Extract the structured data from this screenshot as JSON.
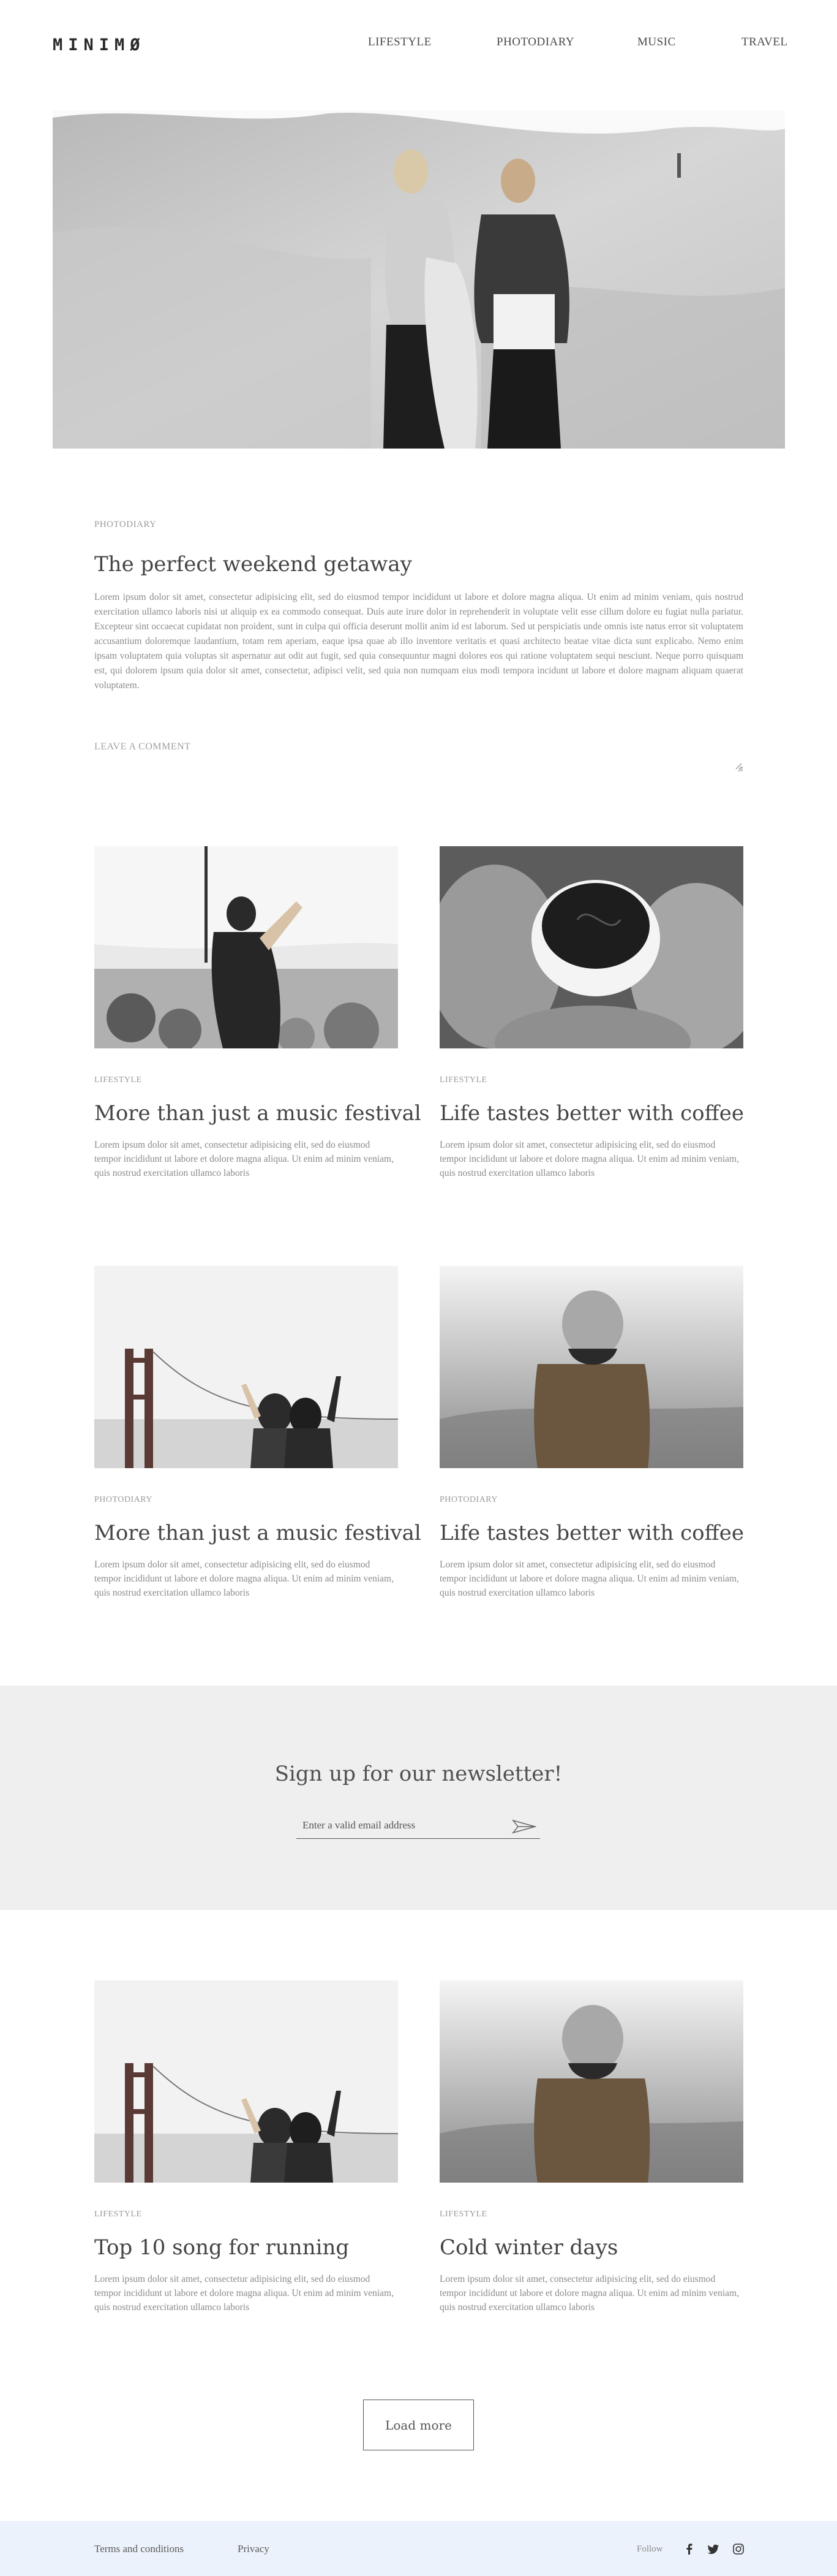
{
  "header": {
    "logo": "MINIMØ",
    "nav": [
      "LIFESTYLE",
      "PHOTODIARY",
      "MUSIC",
      "TRAVEL"
    ]
  },
  "featured": {
    "category": "PHOTODIARY",
    "title": "The perfect weekend getaway",
    "body": "Lorem ipsum dolor sit amet, consectetur adipisicing elit, sed do eiusmod tempor incididunt ut labore et dolore magna aliqua. Ut enim ad minim veniam, quis nostrud exercitation ullamco laboris nisi ut aliquip ex ea commodo consequat. Duis aute irure dolor in reprehenderit in voluptate velit esse cillum dolore eu fugiat nulla pariatur. Excepteur sint occaecat cupidatat non proident, sunt in culpa qui officia deserunt mollit anim id est laborum. Sed ut perspiciatis unde omnis iste natus error sit voluptatem accusantium doloremque laudantium, totam rem aperiam, eaque ipsa quae ab illo inventore veritatis et quasi architecto beatae vitae dicta sunt explicabo. Nemo enim ipsam voluptatem quia voluptas sit aspernatur aut odit aut fugit, sed quia consequuntur magni dolores eos qui ratione voluptatem sequi nesciunt. Neque porro quisquam est, qui dolorem ipsum quia dolor sit amet, consectetur, adipisci velit, sed quia non numquam eius modi tempora incidunt ut labore et dolore magnam aliquam quaerat voluptatem.",
    "comment_label": "LEAVE A COMMENT"
  },
  "posts_row1": [
    {
      "category": "LIFESTYLE",
      "title": "More than just a music festival",
      "excerpt": "Lorem ipsum dolor sit amet, consectetur adipisicing elit, sed do eiusmod tempor incididunt ut labore et dolore magna aliqua. Ut enim ad minim veniam, quis nostrud exercitation ullamco laboris"
    },
    {
      "category": "LIFESTYLE",
      "title": "Life tastes better with coffee",
      "excerpt": "Lorem ipsum dolor sit amet, consectetur adipisicing elit, sed do eiusmod tempor incididunt ut labore et dolore magna aliqua. Ut enim ad minim veniam, quis nostrud exercitation ullamco laboris"
    }
  ],
  "posts_row2": [
    {
      "category": "PHOTODIARY",
      "title": "More than just a music festival",
      "excerpt": "Lorem ipsum dolor sit amet, consectetur adipisicing elit, sed do eiusmod tempor incididunt ut labore et dolore magna aliqua. Ut enim ad minim veniam, quis nostrud exercitation ullamco laboris"
    },
    {
      "category": "PHOTODIARY",
      "title": "Life tastes better with coffee",
      "excerpt": "Lorem ipsum dolor sit amet, consectetur adipisicing elit, sed do eiusmod tempor incididunt ut labore et dolore magna aliqua. Ut enim ad minim veniam, quis nostrud exercitation ullamco laboris"
    }
  ],
  "newsletter": {
    "title": "Sign up for our newsletter!",
    "placeholder": "Enter a valid email address"
  },
  "posts_row3": [
    {
      "category": "LIFESTYLE",
      "title": "Top 10 song for running",
      "excerpt": "Lorem ipsum dolor sit amet, consectetur adipisicing elit, sed do eiusmod tempor incididunt ut labore et dolore magna aliqua. Ut enim ad minim veniam, quis nostrud exercitation ullamco laboris"
    },
    {
      "category": "LIFESTYLE",
      "title": "Cold winter days",
      "excerpt": "Lorem ipsum dolor sit amet, consectetur adipisicing elit, sed do eiusmod tempor incididunt ut labore et dolore magna aliqua. Ut enim ad minim veniam, quis nostrud exercitation ullamco laboris"
    }
  ],
  "load_more": "Load more",
  "footer": {
    "terms": "Terms and conditions",
    "privacy": "Privacy",
    "follow": "Follow",
    "social_icons": [
      "facebook-icon",
      "twitter-icon",
      "instagram-icon"
    ]
  }
}
